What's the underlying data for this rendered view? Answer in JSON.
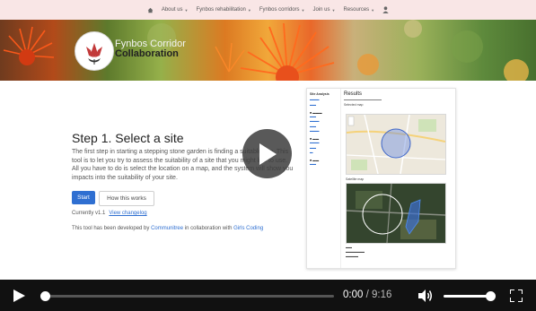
{
  "nav": {
    "items": [
      {
        "label": "About us"
      },
      {
        "label": "Fynbos rehabilitation"
      },
      {
        "label": "Fynbos corridors"
      },
      {
        "label": "Join us"
      },
      {
        "label": "Resources"
      }
    ]
  },
  "header": {
    "title_line1": "Fynbos Corridor",
    "title_line2": "Collaboration"
  },
  "main": {
    "step_title": "Step 1. Select a site",
    "description": "The first step in starting a stepping stone garden is finding a suitable site. This tool is to let you try to assess the suitability of a site that you might like to use. All you have to do is select the location on a map, and the system will show you impacts into the suitability of your site.",
    "start_label": "Start",
    "how_label": "How this works",
    "version_prefix": "Currently v1.1",
    "version_link": "View changelog",
    "dev_prefix": "This tool has been developed by",
    "dev_org": "Communitree",
    "dev_mid": "in collaboration with",
    "dev_partner": "Girls Coding"
  },
  "preview": {
    "sidebar_title": "Site Analysis",
    "title": "Results",
    "selected_label": "Selected map",
    "satellite_label": "Satellite map"
  },
  "player": {
    "current_time": "0:00",
    "separator": "/",
    "duration": "9:16",
    "progress": 0.0,
    "volume": 1.0
  },
  "colors": {
    "accent": "#2f6fd1",
    "nav_bg": "#f9e6e6",
    "control_bg": "#111111"
  }
}
